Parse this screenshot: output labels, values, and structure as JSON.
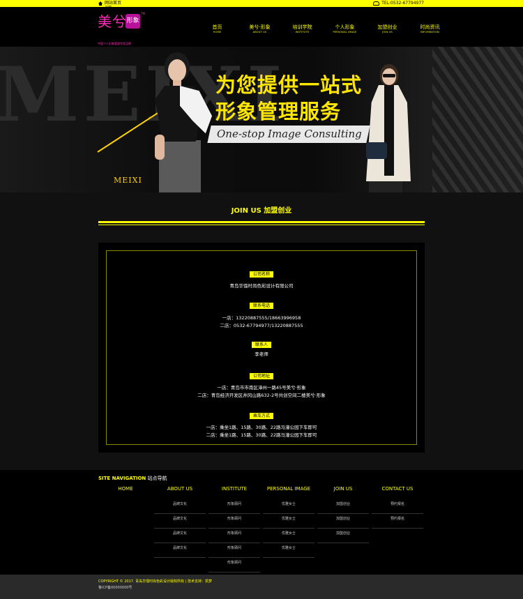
{
  "topbar": {
    "home_label": "网站首页",
    "home_sub": "HOME",
    "tel": "TEL:0532-67794977"
  },
  "logo": {
    "mark": "美兮",
    "badge": "形象",
    "tm": "TM",
    "slogan": "中国个人形象管理专家品牌"
  },
  "nav": [
    {
      "zh": "首页",
      "en": "HOME"
    },
    {
      "zh": "美兮·形象",
      "en": "ABOUT US"
    },
    {
      "zh": "培训学院",
      "en": "INSTITUTE"
    },
    {
      "zh": "个人形象",
      "en": "PERSONAL IMAGE"
    },
    {
      "zh": "加盟创业",
      "en": "JOIN US"
    },
    {
      "zh": "时尚资讯",
      "en": "INFORMATION"
    }
  ],
  "banner": {
    "bg_word": "MEIXI",
    "brand": "MEIXI",
    "headline_1": "为您提供一站式",
    "headline_2": "形象管理服务",
    "tagline": "One-stop Image Consulting"
  },
  "join": {
    "title": "JOIN US 加盟创业"
  },
  "contact": {
    "company_label": "公司名称",
    "company": "青岛华馏时尚色彩设计有限公司",
    "phone_label": "联系电话",
    "phone_1": "一店：13220887555/18663996958",
    "phone_2": "二店：0532-67794977/13220887555",
    "person_label": "联系人",
    "person": "李老师",
    "address_label": "公司地址",
    "address_1": "一店：青岛市市南区漳州一路45号美兮·形象",
    "address_2": "二店：青岛经济开发区井冈山路632-2号共创空间二楼美兮·形象",
    "bus_label": "乘车方式",
    "bus_1": "一店：乘坐1路、15路、30路、22路马濠公园下车即可",
    "bus_2": "二店：乘坐1路、15路、30路、22路马濠公园下车即可"
  },
  "footer": {
    "title_en": "SITE NAVIGATION",
    "title_zh": "站点导航",
    "columns": [
      {
        "head": "HOME",
        "links": []
      },
      {
        "head": "ABOUT US",
        "links": [
          "品牌文化",
          "品牌文化",
          "品牌文化",
          "品牌文化"
        ]
      },
      {
        "head": "INSTITUTE",
        "links": [
          "形象顾问",
          "形象顾问",
          "形象顾问",
          "形象顾问",
          "形象顾问"
        ]
      },
      {
        "head": "PERSONAL IMAGE",
        "links": [
          "优雅女士",
          "优雅女士",
          "优雅女士",
          "优雅女士"
        ]
      },
      {
        "head": "JOIN US",
        "links": [
          "加盟创业",
          "加盟创业",
          "加盟创业"
        ]
      },
      {
        "head": "CONTACT US",
        "links": [
          "预约报名",
          "预约报名"
        ]
      }
    ]
  },
  "copyright": {
    "line_1": "COPYRIGHT © 2017. 青岛华馏时尚色彩设计版权所有 | 技术支持：凯梦",
    "line_2": "鲁ICP备00000000号"
  },
  "colors": {
    "accent": "#ffff00",
    "logo": "#ff2bb8",
    "background": "#111111"
  }
}
